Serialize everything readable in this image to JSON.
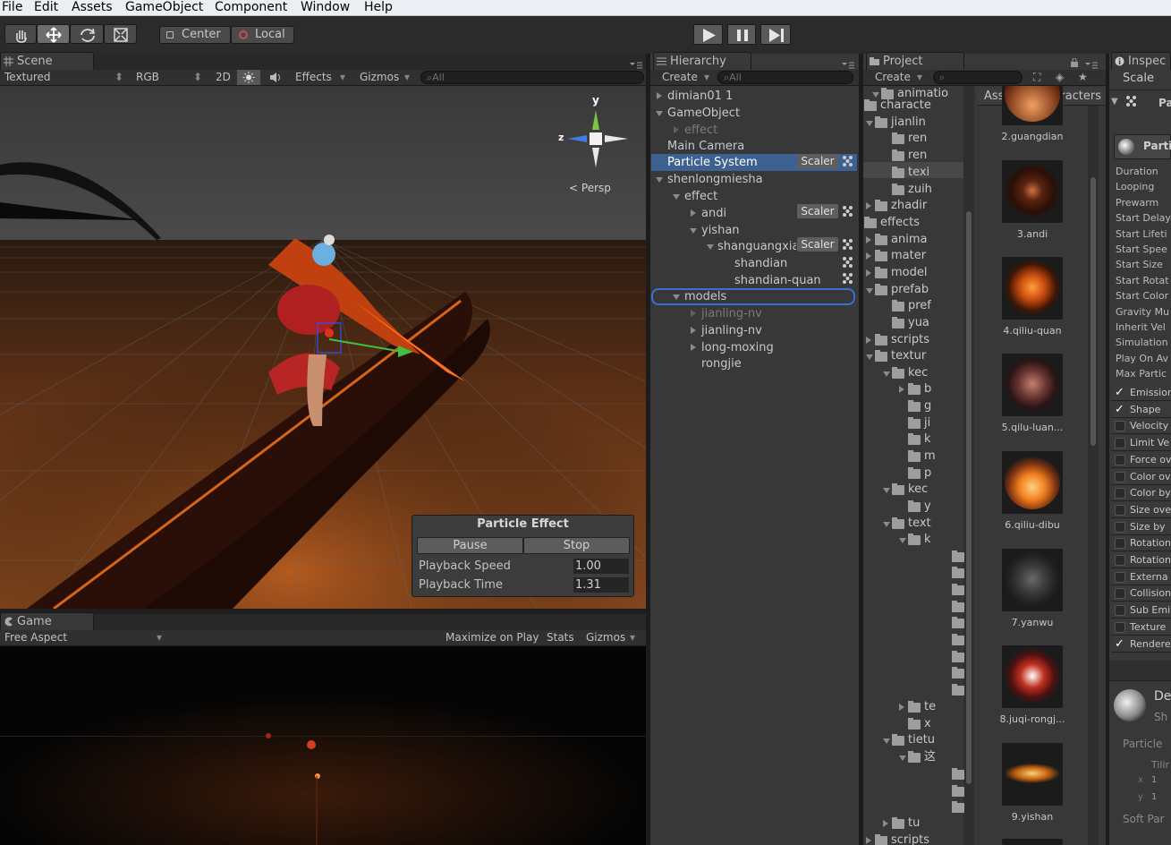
{
  "menu": {
    "file": "File",
    "edit": "Edit",
    "assets": "Assets",
    "gameobject": "GameObject",
    "component": "Component",
    "window": "Window",
    "help": "Help"
  },
  "toolbar": {
    "center": "Center",
    "local": "Local"
  },
  "scene": {
    "tab": "Scene",
    "render_mode": "Textured",
    "color_mode": "RGB",
    "mode_2d": "2D",
    "effects": "Effects",
    "gizmos": "Gizmos",
    "search_placeholder": "⌕All",
    "gizmo": {
      "y": "y",
      "z": "z",
      "persp": "Persp"
    }
  },
  "particle_effect": {
    "title": "Particle Effect",
    "pause": "Pause",
    "stop": "Stop",
    "speed_label": "Playback Speed",
    "speed_value": "1.00",
    "time_label": "Playback Time",
    "time_value": "1.31"
  },
  "game": {
    "tab": "Game",
    "aspect": "Free Aspect",
    "maximize": "Maximize on Play",
    "stats": "Stats",
    "gizmos": "Gizmos"
  },
  "hierarchy": {
    "tab": "Hierarchy",
    "create": "Create",
    "search_placeholder": "⌕All",
    "scaler": "Scaler",
    "rows": [
      {
        "label": "dimian01 1"
      },
      {
        "label": "GameObject"
      },
      {
        "label": "effect"
      },
      {
        "label": "Main Camera"
      },
      {
        "label": "Particle System"
      },
      {
        "label": "shenlongmiesha"
      },
      {
        "label": "effect"
      },
      {
        "label": "andi"
      },
      {
        "label": "yishan"
      },
      {
        "label": "shanguangxia"
      },
      {
        "label": "shandian"
      },
      {
        "label": "shandian-quan"
      },
      {
        "label": "models"
      },
      {
        "label": "jianling-nv"
      },
      {
        "label": "jianling-nv"
      },
      {
        "label": "long-moxing"
      },
      {
        "label": "rongjie"
      }
    ]
  },
  "project": {
    "tab": "Project",
    "create": "Create",
    "breadcrumb_root": "Assets",
    "breadcrumb_child": "characters",
    "tree": [
      {
        "label": "animatio"
      },
      {
        "label": "characte"
      },
      {
        "label": "jianlin"
      },
      {
        "label": "ren"
      },
      {
        "label": "ren"
      },
      {
        "label": "texi"
      },
      {
        "label": "zuih"
      },
      {
        "label": "zhadir"
      },
      {
        "label": "effects"
      },
      {
        "label": "anima"
      },
      {
        "label": "mater"
      },
      {
        "label": "model"
      },
      {
        "label": "prefab"
      },
      {
        "label": "pref"
      },
      {
        "label": "yua"
      },
      {
        "label": "scripts"
      },
      {
        "label": "textur"
      },
      {
        "label": "kec"
      },
      {
        "label": "b"
      },
      {
        "label": "g"
      },
      {
        "label": "ji"
      },
      {
        "label": "k"
      },
      {
        "label": "m"
      },
      {
        "label": "p"
      },
      {
        "label": "kec"
      },
      {
        "label": "y"
      },
      {
        "label": "text"
      },
      {
        "label": "k"
      },
      {
        "label": "te"
      },
      {
        "label": "x"
      },
      {
        "label": "tietu"
      },
      {
        "label": "这"
      },
      {
        "label": "tu"
      },
      {
        "label": "scripts"
      }
    ],
    "assets": [
      {
        "label": "2.guangdian"
      },
      {
        "label": "3.andi"
      },
      {
        "label": "4.qiliu-quan"
      },
      {
        "label": "5.qilu-luan..."
      },
      {
        "label": "6.qiliu-dibu"
      },
      {
        "label": "7.yanwu"
      },
      {
        "label": "8.juqi-rongj..."
      },
      {
        "label": "9.yishan"
      }
    ]
  },
  "inspector": {
    "tab": "Inspec",
    "scale": "Scale",
    "top_label": "Pa",
    "particle_header": "Partic",
    "props": [
      {
        "label": "Duration"
      },
      {
        "label": "Looping"
      },
      {
        "label": "Prewarm"
      },
      {
        "label": "Start Delay"
      },
      {
        "label": "Start Lifeti"
      },
      {
        "label": "Start Spee"
      },
      {
        "label": "Start Size"
      },
      {
        "label": "Start Rotat"
      },
      {
        "label": "Start Color"
      },
      {
        "label": "Gravity Mu"
      },
      {
        "label": "Inherit Vel"
      },
      {
        "label": "Simulation"
      },
      {
        "label": "Play On Av"
      },
      {
        "label": "Max Partic"
      }
    ],
    "modules": [
      {
        "label": "Emission",
        "checked": true
      },
      {
        "label": "Shape",
        "checked": true
      },
      {
        "label": "Velocity",
        "checked": false
      },
      {
        "label": "Limit Ve",
        "checked": false
      },
      {
        "label": "Force ov",
        "checked": false
      },
      {
        "label": "Color ov",
        "checked": false
      },
      {
        "label": "Color by",
        "checked": false
      },
      {
        "label": "Size ove",
        "checked": false
      },
      {
        "label": "Size by",
        "checked": false
      },
      {
        "label": "Rotation",
        "checked": false
      },
      {
        "label": "Rotation",
        "checked": false
      },
      {
        "label": "Externa",
        "checked": false
      },
      {
        "label": "Collision",
        "checked": false
      },
      {
        "label": "Sub Emi",
        "checked": false
      },
      {
        "label": "Texture",
        "checked": false
      },
      {
        "label": "Rendere",
        "checked": true
      }
    ],
    "material_name": "De",
    "material_shader": "Sh",
    "material_section": "Particle",
    "tiling": "Tilir",
    "x_label": "x",
    "x_value": "1",
    "y_label": "y",
    "y_value": "1",
    "soft": "Soft Par"
  }
}
